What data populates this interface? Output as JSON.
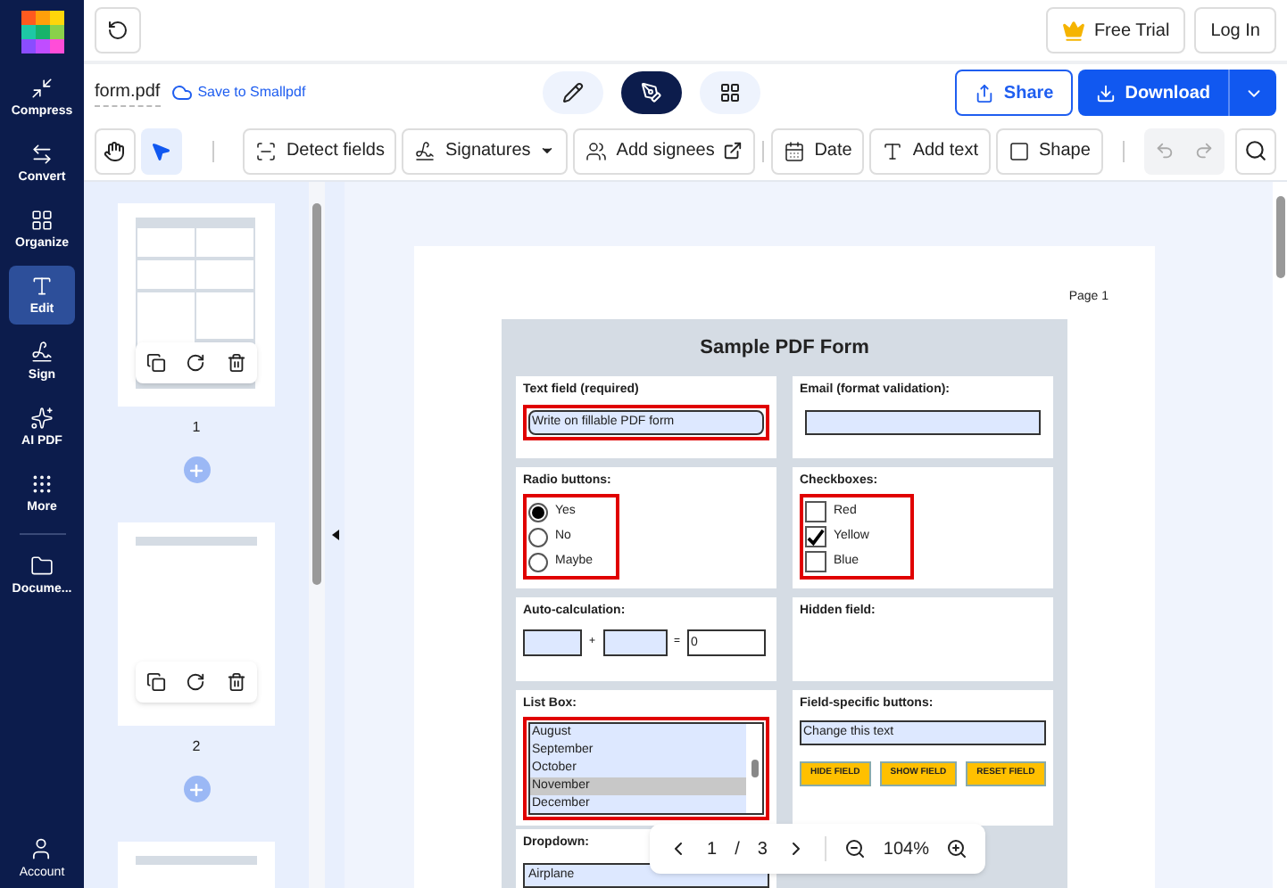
{
  "sidebar": {
    "items": [
      {
        "kind": "compress",
        "label": "Compress",
        "selected": false
      },
      {
        "kind": "convert",
        "label": "Convert",
        "selected": false
      },
      {
        "kind": "organize",
        "label": "Organize",
        "selected": false
      },
      {
        "kind": "edit",
        "label": "Edit",
        "selected": true
      },
      {
        "kind": "sign",
        "label": "Sign",
        "selected": false
      },
      {
        "kind": "ai",
        "label": "AI PDF",
        "selected": false
      },
      {
        "kind": "more",
        "label": "More",
        "selected": false
      },
      {
        "kind": "documents",
        "label": "Docume...",
        "selected": false
      }
    ],
    "account": "Account"
  },
  "topbar": {
    "free_trial": "Free Trial",
    "login": "Log In"
  },
  "file": {
    "name": "form.pdf",
    "save_link": "Save to Smallpdf"
  },
  "view_modes": [
    {
      "kind": "edit",
      "selected": false
    },
    {
      "kind": "sign",
      "selected": true
    },
    {
      "kind": "grid",
      "selected": false
    }
  ],
  "share": "Share",
  "download": "Download",
  "tools": [
    {
      "kind": "hand",
      "selected": false
    },
    {
      "kind": "pointer",
      "selected": true
    }
  ],
  "toolbar": [
    {
      "kind": "detect",
      "label": "Detect fields"
    },
    {
      "kind": "signatures",
      "label": "Signatures"
    },
    {
      "kind": "signees",
      "label": "Add signees"
    },
    {
      "kind": "date",
      "label": "Date"
    },
    {
      "kind": "text",
      "label": "Add text"
    },
    {
      "kind": "shape",
      "label": "Shape"
    }
  ],
  "thumbnails": [
    {
      "kind": "form",
      "label": "1"
    },
    {
      "kind": "blank",
      "label": "2"
    },
    {
      "kind": "blank"
    }
  ],
  "document": {
    "page_label": "Page 1",
    "title": "Sample PDF Form",
    "rows": [
      [
        {
          "kind": "text_field",
          "label": "Text field (required)",
          "value": "Write on fillable PDF form",
          "highlighted": true
        },
        {
          "kind": "text_field",
          "label": "Email (format validation):",
          "highlighted": false
        }
      ],
      [
        {
          "kind": "radio",
          "label": "Radio buttons:",
          "highlighted": true,
          "options": [
            {
              "label": "Yes",
              "selected": true
            },
            {
              "label": "No",
              "selected": false
            },
            {
              "label": "Maybe",
              "selected": false
            }
          ]
        },
        {
          "kind": "checkbox",
          "label": "Checkboxes:",
          "highlighted": true,
          "options": [
            {
              "label": "Red",
              "checked": false
            },
            {
              "label": "Yellow",
              "checked": true
            },
            {
              "label": "Blue",
              "checked": false
            }
          ]
        }
      ],
      [
        {
          "kind": "calc",
          "label": "Auto-calculation:",
          "plus": "+",
          "equals": "=",
          "result": "0"
        },
        {
          "kind": "plain",
          "label": "Hidden field:"
        }
      ],
      [
        {
          "kind": "list",
          "label": "List Box:",
          "highlighted": true,
          "options": [
            {
              "label": "August",
              "selected": false
            },
            {
              "label": "September",
              "selected": false
            },
            {
              "label": "October",
              "selected": false
            },
            {
              "label": "November",
              "selected": true
            },
            {
              "label": "December",
              "selected": false
            }
          ]
        },
        {
          "kind": "buttons",
          "label": "Field-specific buttons:",
          "value": "Change this text",
          "buttons": [
            "HIDE FIELD",
            "SHOW FIELD",
            "RESET FIELD"
          ]
        }
      ],
      [
        {
          "kind": "dropdown",
          "label": "Dropdown:",
          "value": "Airplane"
        }
      ]
    ]
  },
  "pager": {
    "page": "1",
    "separator": "/",
    "total": "3",
    "zoom": "104%"
  }
}
